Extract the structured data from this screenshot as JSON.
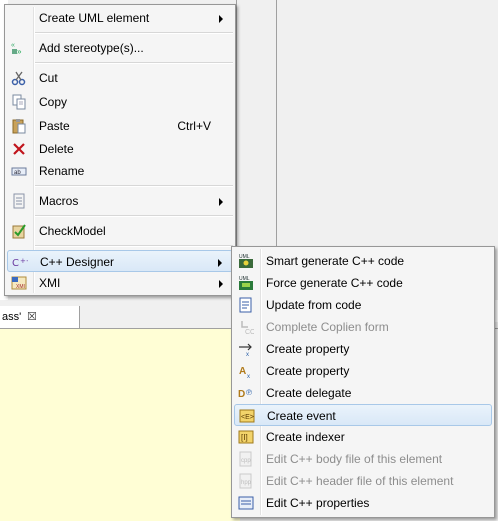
{
  "background": {
    "tab_label": "ass'",
    "tab_close": "☒",
    "editor_color": "#fffed5"
  },
  "context_menu": {
    "items": [
      {
        "label": "Create UML element",
        "icon": "none",
        "submenu": true
      },
      {
        "label": "Add stereotype(s)...",
        "icon": "stereotype-icon"
      },
      {
        "label": "Cut",
        "icon": "scissors-icon"
      },
      {
        "label": "Copy",
        "icon": "copy-icon"
      },
      {
        "label": "Paste",
        "icon": "paste-icon",
        "shortcut": "Ctrl+V"
      },
      {
        "label": "Delete",
        "icon": "delete-x-icon"
      },
      {
        "label": "Rename",
        "icon": "rename-icon"
      },
      {
        "label": "Macros",
        "icon": "macro-icon",
        "submenu": true
      },
      {
        "label": "CheckModel",
        "icon": "checkmodel-icon"
      },
      {
        "label": "C++ Designer",
        "icon": "cpp-designer-icon",
        "submenu": true,
        "highlighted": true
      },
      {
        "label": "XMI",
        "icon": "xmi-icon",
        "submenu": true
      }
    ]
  },
  "submenu": {
    "items": [
      {
        "label": "Smart generate C++ code",
        "icon": "smart-generate-icon"
      },
      {
        "label": "Force generate C++ code",
        "icon": "force-generate-icon"
      },
      {
        "label": "Update from code",
        "icon": "update-code-icon"
      },
      {
        "label": "Complete Coplien form",
        "icon": "coplien-icon",
        "disabled": true
      },
      {
        "label": "Create property",
        "icon": "create-property-icon"
      },
      {
        "label": "Create property",
        "icon": "create-property-alt-icon"
      },
      {
        "label": "Create delegate",
        "icon": "create-delegate-icon"
      },
      {
        "label": "Create event",
        "icon": "create-event-icon",
        "highlighted": true
      },
      {
        "label": "Create indexer",
        "icon": "create-indexer-icon"
      },
      {
        "label": "Edit C++ body file of this element",
        "icon": "body-file-icon",
        "disabled": true
      },
      {
        "label": "Edit C++ header file of this element",
        "icon": "header-file-icon",
        "disabled": true
      },
      {
        "label": "Edit C++ properties",
        "icon": "cpp-properties-icon"
      }
    ]
  },
  "colors": {
    "menu_bg": "#f5f5f5",
    "hover_border": "#a8c8e8",
    "disabled_text": "#8d8d8d"
  }
}
